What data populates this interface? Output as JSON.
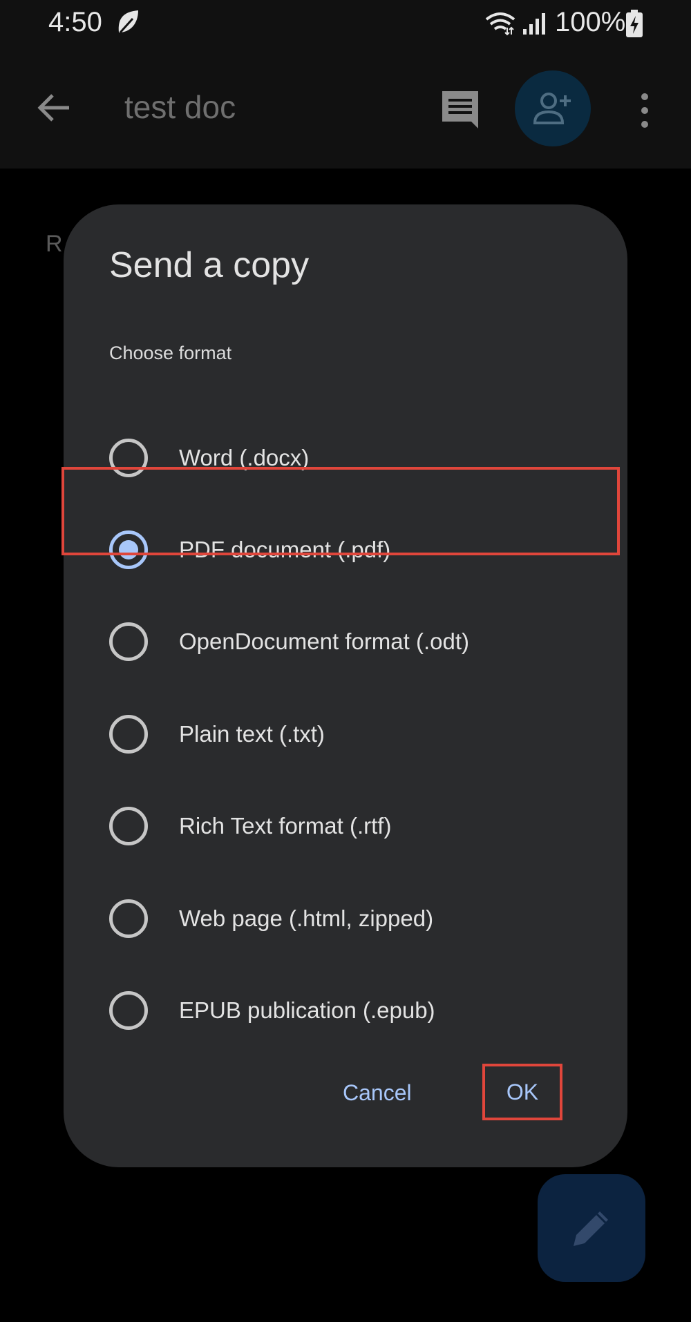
{
  "status_bar": {
    "time": "4:50",
    "battery_percent": "100%",
    "icons": [
      "leaf-icon",
      "wifi-icon",
      "signal-icon",
      "battery-charging-icon"
    ]
  },
  "app_bar": {
    "title": "test doc",
    "icons": [
      "back-arrow-icon",
      "comment-icon",
      "add-person-icon",
      "more-vert-icon"
    ]
  },
  "background": {
    "partial_text": "R"
  },
  "dialog": {
    "title": "Send a copy",
    "subtitle": "Choose format",
    "options": [
      {
        "label": "Word (.docx)",
        "selected": false
      },
      {
        "label": "PDF document (.pdf)",
        "selected": true
      },
      {
        "label": "OpenDocument format (.odt)",
        "selected": false
      },
      {
        "label": "Plain text (.txt)",
        "selected": false
      },
      {
        "label": "Rich Text format (.rtf)",
        "selected": false
      },
      {
        "label": "Web page (.html, zipped)",
        "selected": false
      },
      {
        "label": "EPUB publication (.epub)",
        "selected": false
      }
    ],
    "cancel_label": "Cancel",
    "ok_label": "OK"
  },
  "fab": {
    "icon": "pencil-icon"
  },
  "colors": {
    "dialog_bg": "#2a2b2d",
    "accent": "#a8c7fa",
    "highlight": "#e0463b",
    "app_bar_bg": "#111111"
  }
}
